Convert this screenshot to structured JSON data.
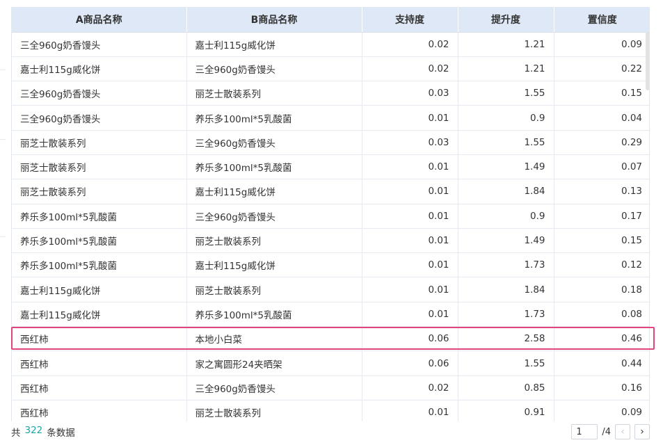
{
  "table": {
    "headers": [
      "A商品名称",
      "B商品名称",
      "支持度",
      "提升度",
      "置信度"
    ],
    "rows": [
      [
        "三全960g奶香馒头",
        "嘉士利115g威化饼",
        "0.02",
        "1.21",
        "0.09"
      ],
      [
        "嘉士利115g威化饼",
        "三全960g奶香馒头",
        "0.02",
        "1.21",
        "0.22"
      ],
      [
        "三全960g奶香馒头",
        "丽芝士散装系列",
        "0.03",
        "1.55",
        "0.15"
      ],
      [
        "三全960g奶香馒头",
        "养乐多100ml*5乳酸菌",
        "0.01",
        "0.9",
        "0.04"
      ],
      [
        "丽芝士散装系列",
        "三全960g奶香馒头",
        "0.03",
        "1.55",
        "0.29"
      ],
      [
        "丽芝士散装系列",
        "养乐多100ml*5乳酸菌",
        "0.01",
        "1.49",
        "0.07"
      ],
      [
        "丽芝士散装系列",
        "嘉士利115g威化饼",
        "0.01",
        "1.84",
        "0.13"
      ],
      [
        "养乐多100ml*5乳酸菌",
        "三全960g奶香馒头",
        "0.01",
        "0.9",
        "0.17"
      ],
      [
        "养乐多100ml*5乳酸菌",
        "丽芝士散装系列",
        "0.01",
        "1.49",
        "0.15"
      ],
      [
        "养乐多100ml*5乳酸菌",
        "嘉士利115g威化饼",
        "0.01",
        "1.73",
        "0.12"
      ],
      [
        "嘉士利115g威化饼",
        "丽芝士散装系列",
        "0.01",
        "1.84",
        "0.18"
      ],
      [
        "嘉士利115g威化饼",
        "养乐多100ml*5乳酸菌",
        "0.01",
        "1.73",
        "0.08"
      ],
      [
        "西红柿",
        "本地小白菜",
        "0.06",
        "2.58",
        "0.46"
      ],
      [
        "西红柿",
        "家之寓圆形24夹晒架",
        "0.06",
        "1.55",
        "0.44"
      ],
      [
        "西红柿",
        "三全960g奶香馒头",
        "0.02",
        "0.85",
        "0.16"
      ],
      [
        "西红柿",
        "丽芝士散装系列",
        "0.01",
        "0.91",
        "0.09"
      ]
    ]
  },
  "footer": {
    "total_prefix": "共",
    "total_count": "322",
    "total_suffix": "条数据",
    "page_value": "1",
    "page_total": "/4",
    "prev_icon": "chevron-left-icon",
    "next_icon": "chevron-right-icon"
  },
  "colors": {
    "header_bg": "#dfe8f7",
    "highlight_border": "#e2447d",
    "count_accent": "#1ba6a6"
  }
}
